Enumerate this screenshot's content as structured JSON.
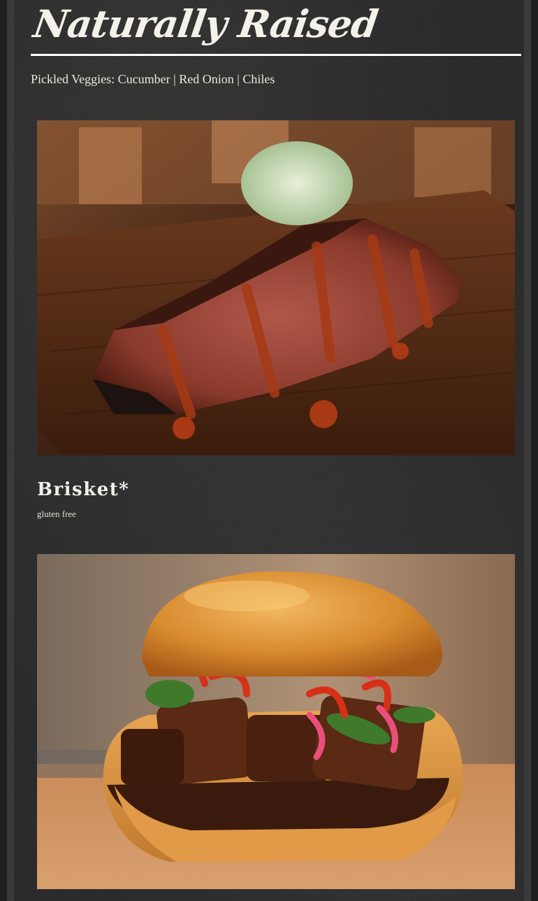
{
  "section": {
    "title": "Naturally Raised",
    "subtitle": "Pickled Veggies: Cucumber | Red Onion | Chiles"
  },
  "items": [
    {
      "name": "Brisket*",
      "tag": "gluten free"
    }
  ],
  "colors": {
    "background": "#2a2a2a",
    "text": "#f4f1ea",
    "rule": "#ffffff"
  }
}
